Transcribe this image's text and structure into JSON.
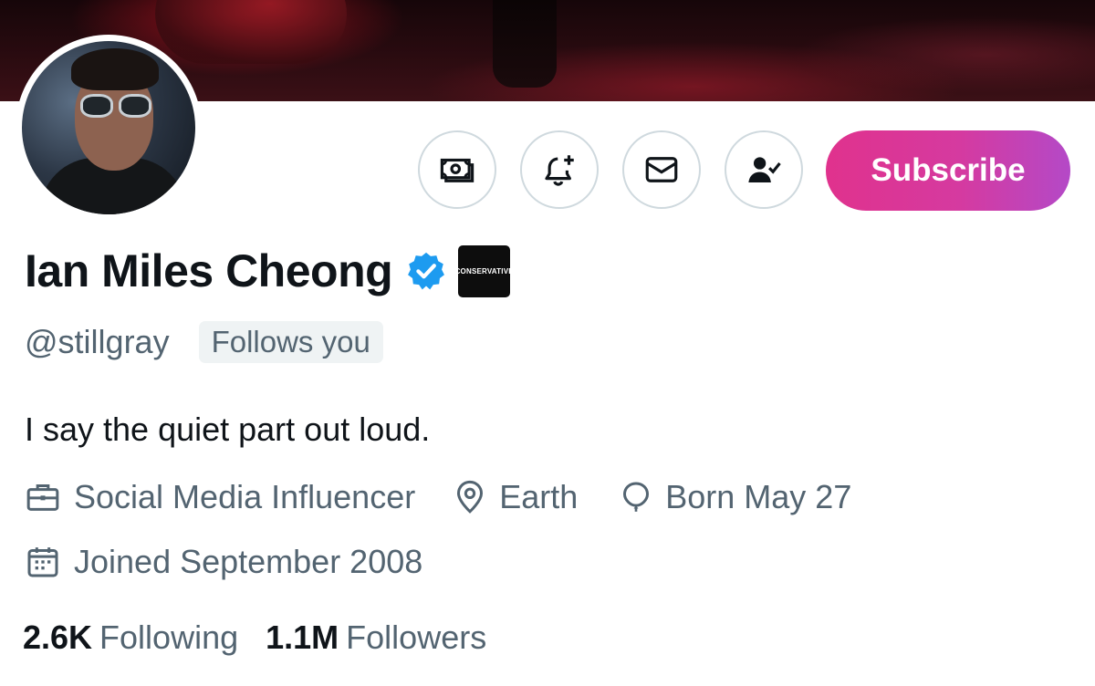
{
  "profile": {
    "name": "Ian Miles Cheong",
    "affiliate_badge": "CONSERVATIVE",
    "handle": "@stillgray",
    "follows_you": "Follows you",
    "bio": "I say the quiet part out loud.",
    "category": "Social Media Influencer",
    "location": "Earth",
    "birthday": "Born May 27",
    "joined": "Joined September 2008"
  },
  "stats": {
    "following_count": "2.6K",
    "following_label": "Following",
    "followers_count": "1.1M",
    "followers_label": "Followers"
  },
  "actions": {
    "subscribe_label": "Subscribe",
    "tip_icon": "money-icon",
    "notify_icon": "bell-plus-icon",
    "message_icon": "mail-icon",
    "following_icon": "person-check-icon"
  },
  "colors": {
    "verified": "#1d9bf0",
    "muted_text": "#536471",
    "subscribe_gradient_start": "#e0328d",
    "subscribe_gradient_end": "#b449c7"
  }
}
